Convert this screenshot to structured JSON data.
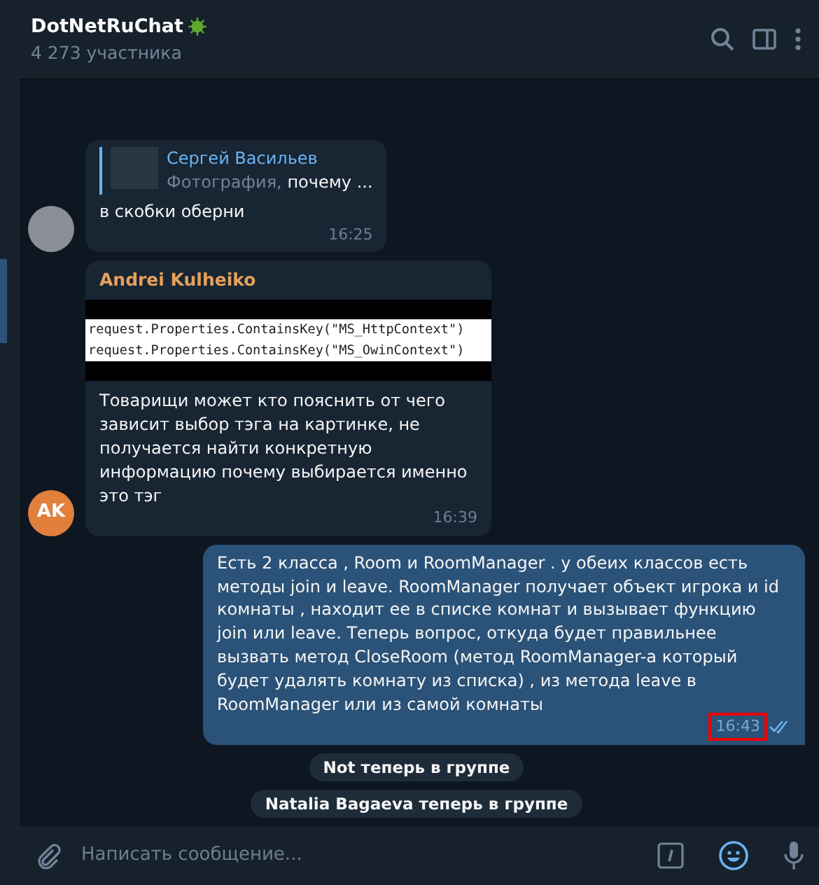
{
  "header": {
    "title": "DotNetRuChat",
    "subtitle": "4 273 участника"
  },
  "messages": [
    {
      "kind": "incoming",
      "reply": {
        "name": "Сергей Васильев",
        "label": "Фотография,",
        "text": "почему ..."
      },
      "text": "в скобки оберни",
      "time": "16:25"
    },
    {
      "kind": "incoming",
      "initials": "AK",
      "author": "Andrei Kulheiko",
      "code": [
        "request.Properties.ContainsKey(\"MS_HttpContext\")",
        "request.Properties.ContainsKey(\"MS_OwinContext\")"
      ],
      "text": "Товарищи может кто пояснить от чего зависит выбор тэга на картинке, не получается найти конкретную информацию почему выбирается именно это тэг",
      "time": "16:39"
    },
    {
      "kind": "outgoing",
      "text": "Есть 2 класса , Room и RoomManager . у обеих классов есть методы join и leave. RoomManager получает объект игрока и id комнаты , находит ее в списке комнат и вызывает функцию join или leave. Теперь вопрос, откуда будет правильнее вызвать метод CloseRoom (метод RoomManager-а  который будет удалять комнату из списка) , из метода leave в RoomManager или из самой комнаты",
      "time": "16:43",
      "time_highlighted": true,
      "read": true
    },
    {
      "kind": "service",
      "text": "Not теперь в группе"
    },
    {
      "kind": "service",
      "text": "Natalia Bagaeva теперь в группе"
    }
  ],
  "composer": {
    "placeholder": "Написать сообщение..."
  }
}
